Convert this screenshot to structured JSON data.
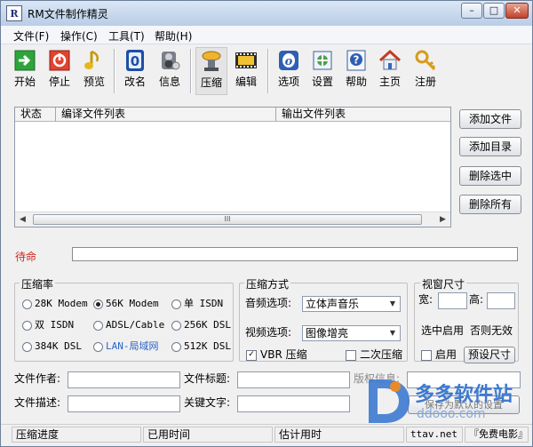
{
  "window": {
    "title": "RM文件制作精灵",
    "app_icon_text": "R",
    "min": "–",
    "max": "□",
    "close": "✕"
  },
  "menu": [
    "文件(F)",
    "操作(C)",
    "工具(T)",
    "帮助(H)"
  ],
  "toolbar": {
    "start": "开始",
    "stop": "停止",
    "preview": "预览",
    "rename": "改名",
    "info": "信息",
    "compress": "压缩",
    "edit": "编辑",
    "options": "选项",
    "settings": "设置",
    "help": "帮助",
    "home": "主页",
    "register": "注册"
  },
  "filelist": {
    "columns": [
      "状态",
      "编译文件列表",
      "输出文件列表"
    ],
    "scroll_left": "◀",
    "scroll_right": "▶",
    "thumb_grip": "III"
  },
  "actions": {
    "add_file": "添加文件",
    "add_dir": "添加目录",
    "delete_selected": "删除选中",
    "delete_all": "删除所有"
  },
  "status": {
    "text": "待命"
  },
  "ratio": {
    "label": "压缩率",
    "options": [
      "28K Modem",
      "56K Modem",
      "单 ISDN",
      "双 ISDN",
      "ADSL/Cable",
      "256K DSL",
      "384K DSL",
      "LAN-局域网",
      "512K DSL"
    ],
    "selected": "56K Modem",
    "highlight": "LAN-局域网",
    "highlight_color": "#2a64c8"
  },
  "mode": {
    "label": "压缩方式",
    "audio_label": "音频选项:",
    "audio_value": "立体声音乐",
    "video_label": "视频选项:",
    "video_value": "图像增亮",
    "vbr_label": "VBR 压缩",
    "vbr_checked": true,
    "twopass_label": "二次压缩",
    "twopass_checked": false,
    "combo_arrow": "▼"
  },
  "window_size": {
    "label": "视窗尺寸",
    "width_label": "宽:",
    "height_label": "高:",
    "note_enabled": "选中启用",
    "note_disabled": "否则无效",
    "enable_label": "启用",
    "enable_checked": false,
    "preset_button": "预设尺寸"
  },
  "meta": {
    "author_label": "文件作者:",
    "title_label": "文件标题:",
    "copyright_label": "版权信息:",
    "desc_label": "文件描述:",
    "keyword_label": "关键文字:",
    "save_default": "保存为默认的设置"
  },
  "statusbar": {
    "progress": "压缩进度",
    "elapsed": "已用时间",
    "estimate": "估计用时",
    "site": "ttav.net",
    "brand": "『免费电影』"
  },
  "watermark": {
    "name": "多多软件站",
    "url": "ddooo.com"
  }
}
